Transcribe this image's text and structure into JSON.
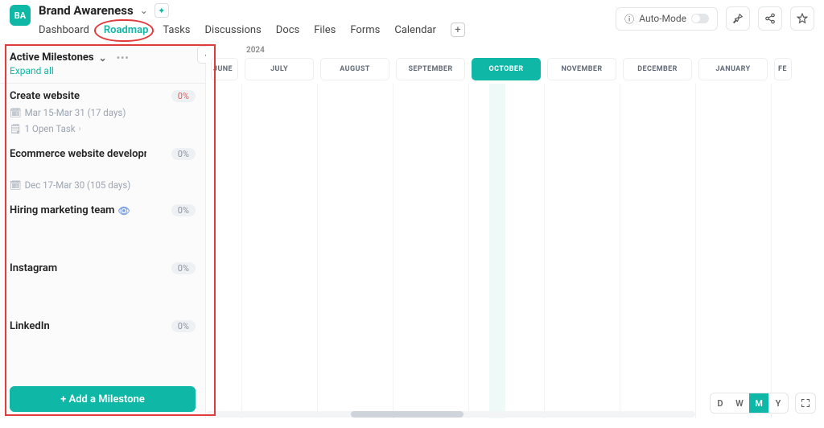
{
  "project": {
    "initials": "BA",
    "title": "Brand Awareness"
  },
  "header_actions": {
    "auto_mode": "Auto-Mode"
  },
  "tabs": [
    "Dashboard",
    "Roadmap",
    "Tasks",
    "Discussions",
    "Docs",
    "Files",
    "Forms",
    "Calendar"
  ],
  "sidebar": {
    "heading": "Active Milestones",
    "expand": "Expand all",
    "add_btn": "+ Add a Milestone"
  },
  "milestones": [
    {
      "title": "Create website",
      "percent": "0%",
      "percent_red": true,
      "date": "Mar 15-Mar 31 (17 days)",
      "tasks": "1 Open Task",
      "has_tasks": true
    },
    {
      "title": "Ecommerce website developme...",
      "percent": "0%",
      "date": "Dec 17-Mar 30 (105 days)"
    },
    {
      "title": "Hiring marketing team",
      "percent": "0%",
      "eye": true
    },
    {
      "title": "Instagram",
      "percent": "0%"
    },
    {
      "title": "LinkedIn",
      "percent": "0%"
    }
  ],
  "timeline": {
    "year": "2024",
    "months": [
      "JUNE",
      "JULY",
      "AUGUST",
      "SEPTEMBER",
      "OCTOBER",
      "NOVEMBER",
      "DECEMBER",
      "JANUARY",
      "FE"
    ],
    "active_month_index": 4,
    "zoom": [
      "D",
      "W",
      "M",
      "Y"
    ],
    "zoom_active": 2
  }
}
